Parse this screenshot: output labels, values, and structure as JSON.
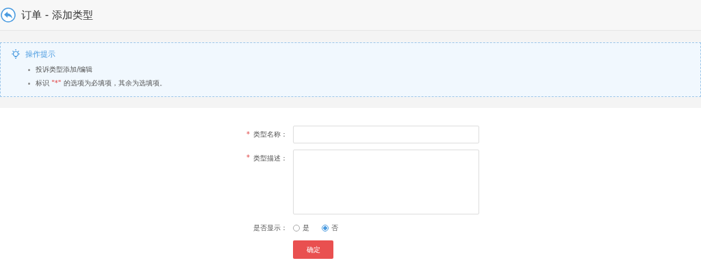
{
  "header": {
    "title": "订单 - 添加类型"
  },
  "tips": {
    "title": "操作提示",
    "items": [
      {
        "before": "投诉类型添加/编辑"
      },
      {
        "before": "标识 ",
        "marked": "\"*\"",
        "after": " 的选项为必填项，其余为选填项。"
      }
    ]
  },
  "form": {
    "fields": [
      {
        "kind": "input",
        "required_mark": "*",
        "label": "类型名称："
      },
      {
        "kind": "textarea",
        "required_mark": "*",
        "label": "类型描述："
      },
      {
        "kind": "radio",
        "label": "是否显示：",
        "options": [
          {
            "label": "是",
            "selected": false
          },
          {
            "label": "否",
            "selected": true
          }
        ]
      }
    ],
    "submit": "确定"
  }
}
